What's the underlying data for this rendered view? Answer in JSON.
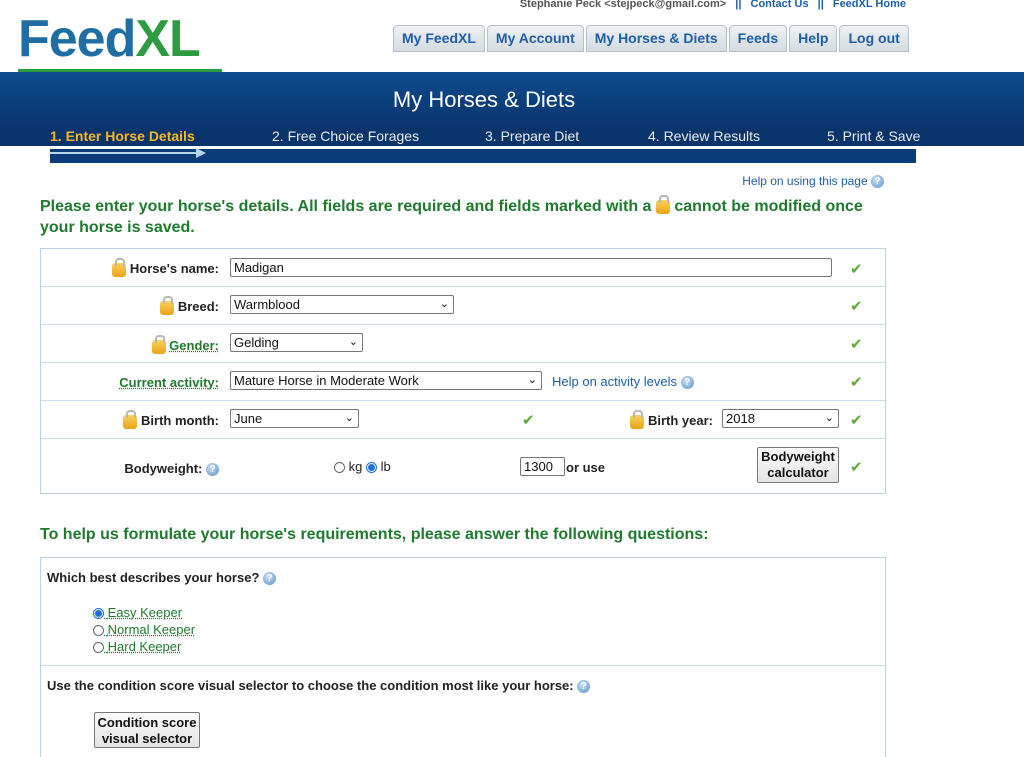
{
  "header": {
    "logo": {
      "main": "Feed",
      "accent": "XL"
    },
    "user": "Stephanie Peck <stejpeck@gmail.com>",
    "contact_link": "Contact Us",
    "home_link": "FeedXL Home",
    "separator": "||",
    "nav": [
      "My FeedXL",
      "My Account",
      "My Horses & Diets",
      "Feeds",
      "Help",
      "Log out"
    ]
  },
  "banner": {
    "title": "My Horses & Diets",
    "steps": [
      "1. Enter Horse Details",
      "2. Free Choice Forages",
      "3. Prepare Diet",
      "4. Review Results",
      "5. Print & Save"
    ],
    "active_step": 0
  },
  "help_page": "Help on using this page",
  "intro": {
    "part1": "Please enter your horse's details. All fields are required and fields marked with a",
    "part2": "cannot be modified once your horse is saved."
  },
  "form": {
    "name_label": "Horse's name:",
    "name_value": "Madigan",
    "breed_label": "Breed:",
    "breed_value": "Warmblood",
    "gender_label": "Gender:",
    "gender_value": "Gelding",
    "activity_label": "Current activity:",
    "activity_value": "Mature Horse in Moderate Work",
    "activity_help": "Help on activity levels",
    "birth_month_label": "Birth month:",
    "birth_month_value": "June",
    "birth_year_label": "Birth year:",
    "birth_year_value": "2018",
    "bodyweight_label": "Bodyweight:",
    "unit_kg": "kg",
    "unit_lb": "lb",
    "bodyweight_value": "1300",
    "or_use": "or use",
    "calc_line1": "Bodyweight",
    "calc_line2": "calculator"
  },
  "questions": {
    "title": "To help us formulate your horse's requirements, please answer the following questions:",
    "q1": "Which best describes your horse?",
    "q1_options": [
      "Easy Keeper",
      "Normal Keeper",
      "Hard Keeper"
    ],
    "q2": "Use the condition score visual selector to choose the condition most like your horse:",
    "cs_line1": "Condition score",
    "cs_line2": "visual selector"
  }
}
